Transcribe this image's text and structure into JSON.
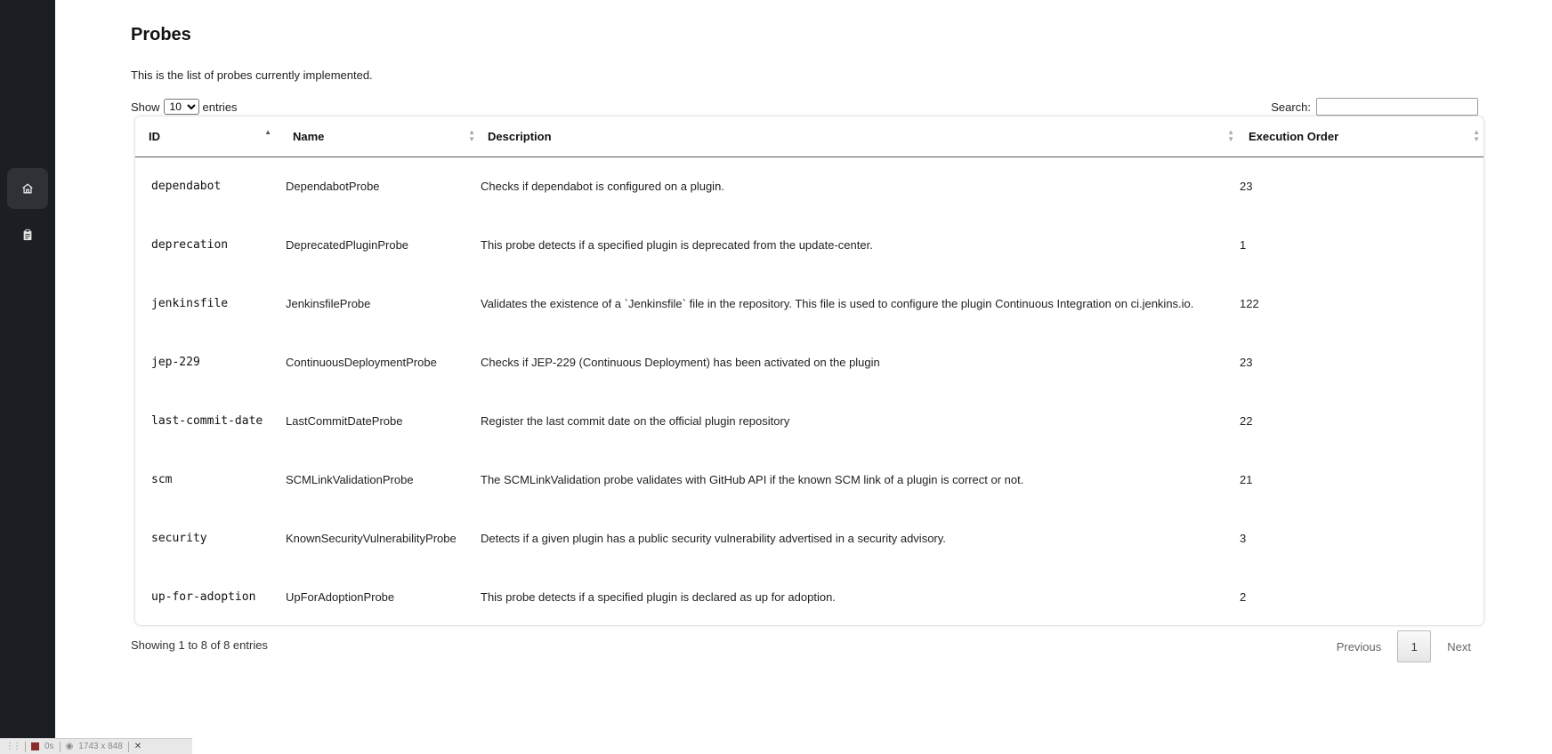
{
  "page": {
    "title": "Probes",
    "intro": "This is the list of probes currently implemented."
  },
  "controls": {
    "show_label": "Show",
    "entries_value": "10",
    "entries_label": "entries",
    "search_label": "Search:"
  },
  "table": {
    "headers": [
      "ID",
      "Name",
      "Description",
      "Execution Order"
    ],
    "rows": [
      {
        "id": "dependabot",
        "name": "DependabotProbe",
        "description": "Checks if dependabot is configured on a plugin.",
        "order": "23"
      },
      {
        "id": "deprecation",
        "name": "DeprecatedPluginProbe",
        "description": "This probe detects if a specified plugin is deprecated from the update-center.",
        "order": "1"
      },
      {
        "id": "jenkinsfile",
        "name": "JenkinsfileProbe",
        "description": "Validates the existence of a `Jenkinsfile` file in the repository. This file is used to configure the plugin Continuous Integration on ci.jenkins.io.",
        "order": "122"
      },
      {
        "id": "jep-229",
        "name": "ContinuousDeploymentProbe",
        "description": "Checks if JEP-229 (Continuous Deployment) has been activated on the plugin",
        "order": "23"
      },
      {
        "id": "last-commit-date",
        "name": "LastCommitDateProbe",
        "description": "Register the last commit date on the official plugin repository",
        "order": "22"
      },
      {
        "id": "scm",
        "name": "SCMLinkValidationProbe",
        "description": "The SCMLinkValidation probe validates with GitHub API if the known SCM link of a plugin is correct or not.",
        "order": "21"
      },
      {
        "id": "security",
        "name": "KnownSecurityVulnerabilityProbe",
        "description": "Detects if a given plugin has a public security vulnerability advertised in a security advisory.",
        "order": "3"
      },
      {
        "id": "up-for-adoption",
        "name": "UpForAdoptionProbe",
        "description": "This probe detects if a specified plugin is declared as up for adoption.",
        "order": "2"
      }
    ]
  },
  "footer": {
    "info": "Showing 1 to 8 of 8 entries",
    "previous": "Previous",
    "current_page": "1",
    "next": "Next"
  },
  "devbar": {
    "timer": "0s",
    "size": "1743 x 848"
  },
  "colors": {
    "sidebar": "#1b1e22",
    "sidebar_active": "#2e3237"
  },
  "icons": {
    "sidebar": [
      "home-icon",
      "clipboard-icon"
    ]
  }
}
